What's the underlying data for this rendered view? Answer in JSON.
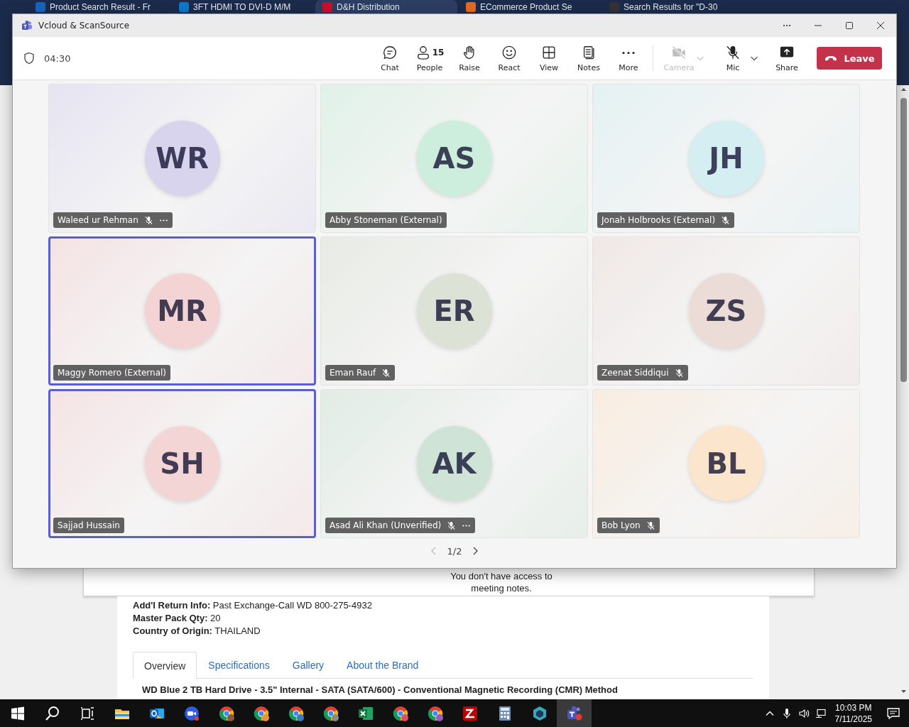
{
  "browser": {
    "tabs": [
      {
        "title": "Product Search Result - Fr",
        "selected": false
      },
      {
        "title": "3FT HDMI TO DVI-D M/M",
        "selected": false
      },
      {
        "title": "D&H Distribution",
        "selected": true
      },
      {
        "title": "ECommerce Product Se",
        "selected": false
      },
      {
        "title": "Search Results for \"D-30",
        "selected": false
      }
    ]
  },
  "page": {
    "notes_message": "You don't have access to meeting notes.",
    "details": [
      "**Add'l Return Info:** Past Exchange-Call WD 800-275-4932",
      "**Master Pack Qty:** 20",
      "**Country of Origin:** THAILAND"
    ],
    "tabs": [
      {
        "label": "Overview",
        "selected": true
      },
      {
        "label": "Specifications",
        "selected": false
      },
      {
        "label": "Gallery",
        "selected": false
      },
      {
        "label": "About the Brand",
        "selected": false
      }
    ],
    "heading": "WD Blue 2 TB Hard Drive - 3.5\" Internal - SATA (SATA/600) - Conventional Magnetic Recording (CMR) Method"
  },
  "meeting_window": {
    "title": "Vcloud & ScanSource",
    "timer": "04:30",
    "toolbar": [
      {
        "kind": "chat",
        "label": "Chat",
        "disabled": false,
        "dropdown": false
      },
      {
        "kind": "people",
        "label": "People",
        "count": "15",
        "disabled": false,
        "dropdown": false
      },
      {
        "kind": "raise",
        "label": "Raise",
        "disabled": false,
        "dropdown": false
      },
      {
        "kind": "react",
        "label": "React",
        "disabled": false,
        "dropdown": false
      },
      {
        "kind": "view",
        "label": "View",
        "disabled": false,
        "dropdown": false
      },
      {
        "kind": "notes",
        "label": "Notes",
        "disabled": false,
        "dropdown": false
      },
      {
        "kind": "more",
        "label": "More",
        "disabled": false,
        "dropdown": false
      },
      {
        "kind": "camera",
        "label": "Camera",
        "disabled": true,
        "dropdown": true
      },
      {
        "kind": "mic",
        "label": "Mic",
        "disabled": false,
        "dropdown": true
      },
      {
        "kind": "share",
        "label": "Share",
        "disabled": false,
        "dropdown": false
      }
    ],
    "leave_button": "Leave",
    "participants": [
      {
        "initials": "WR",
        "name": "Waleed ur Rehman",
        "color": "#d9d4ee",
        "muted": true,
        "more": true,
        "highlighted": false
      },
      {
        "initials": "AS",
        "name": "Abby Stoneman (External)",
        "color": "#cdeedc",
        "muted": false,
        "more": false,
        "highlighted": false
      },
      {
        "initials": "JH",
        "name": "Jonah Holbrooks (External)",
        "color": "#d5eef1",
        "muted": true,
        "more": false,
        "highlighted": false
      },
      {
        "initials": "MR",
        "name": "Maggy Romero (External)",
        "color": "#f3d3d4",
        "muted": false,
        "more": false,
        "highlighted": true
      },
      {
        "initials": "ER",
        "name": "Eman Rauf",
        "color": "#dce2d5",
        "muted": true,
        "more": false,
        "highlighted": false
      },
      {
        "initials": "ZS",
        "name": "Zeenat Siddiqui",
        "color": "#ebdcd8",
        "muted": true,
        "more": false,
        "highlighted": false
      },
      {
        "initials": "SH",
        "name": "Sajjad Hussain",
        "color": "#f4d5d6",
        "muted": false,
        "more": false,
        "highlighted": true
      },
      {
        "initials": "AK",
        "name": "Asad Ali Khan (Unverified)",
        "color": "#cfe4d6",
        "muted": true,
        "more": true,
        "highlighted": false
      },
      {
        "initials": "BL",
        "name": "Bob Lyon",
        "color": "#fce5cd",
        "muted": true,
        "more": false,
        "highlighted": false
      }
    ],
    "pagination": "1/2"
  },
  "taskbar": {
    "apps": [
      {
        "kind": "start"
      },
      {
        "kind": "search"
      },
      {
        "kind": "taskview"
      },
      {
        "kind": "explorer"
      },
      {
        "kind": "outlook"
      },
      {
        "kind": "zoom"
      },
      {
        "kind": "chrome",
        "color": "#8a5a3c"
      },
      {
        "kind": "chrome",
        "color": "#e8903a"
      },
      {
        "kind": "chrome",
        "color": "#3a78c8"
      },
      {
        "kind": "chrome",
        "color": "#8a8a8a"
      },
      {
        "kind": "excel"
      },
      {
        "kind": "chrome",
        "color": "#d9506a"
      },
      {
        "kind": "chrome",
        "color": "#9b59c6"
      },
      {
        "kind": "filezilla"
      },
      {
        "kind": "calculator"
      },
      {
        "kind": "app"
      },
      {
        "kind": "teams"
      }
    ],
    "tray": {
      "time": "10:03 PM",
      "date": "7/11/2025"
    }
  }
}
